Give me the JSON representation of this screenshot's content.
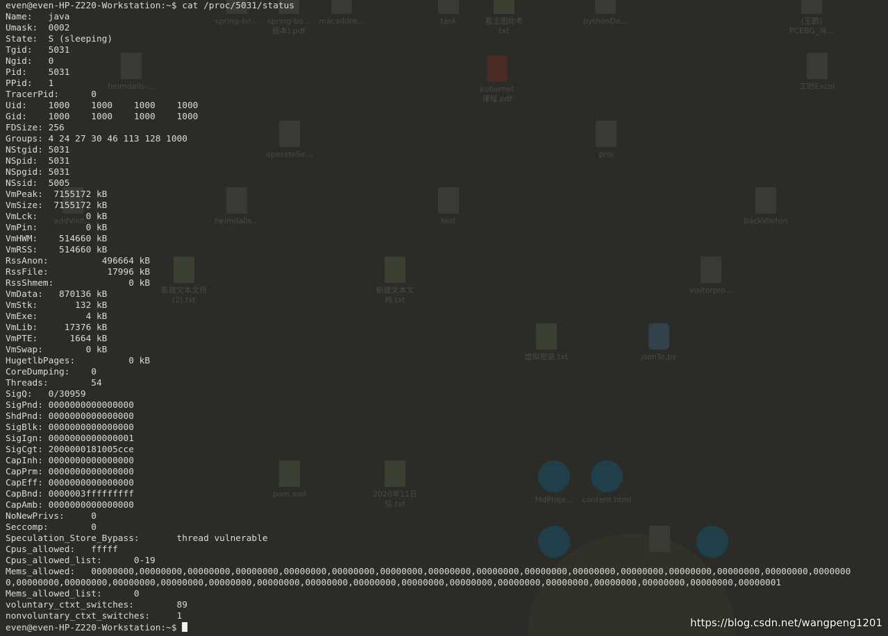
{
  "terminal": {
    "prompt": "even@even-HP-Z220-Workstation:~$",
    "command": "cat /proc/5031/status",
    "output": [
      "Name:\tjava",
      "Umask:\t0002",
      "State:\tS (sleeping)",
      "Tgid:\t5031",
      "Ngid:\t0",
      "Pid:\t5031",
      "PPid:\t1",
      "TracerPid:\t0",
      "Uid:\t1000\t1000\t1000\t1000",
      "Gid:\t1000\t1000\t1000\t1000",
      "FDSize:\t256",
      "Groups:\t4 24 27 30 46 113 128 1000",
      "NStgid:\t5031",
      "NSpid:\t5031",
      "NSpgid:\t5031",
      "NSsid:\t5005",
      "VmPeak:\t 7155172 kB",
      "VmSize:\t 7155172 kB",
      "VmLck:\t       0 kB",
      "VmPin:\t       0 kB",
      "VmHWM:\t  514660 kB",
      "VmRSS:\t  514660 kB",
      "RssAnon:\t  496664 kB",
      "RssFile:\t   17996 kB",
      "RssShmem:\t       0 kB",
      "VmData:\t  870136 kB",
      "VmStk:\t     132 kB",
      "VmExe:\t       4 kB",
      "VmLib:\t   17376 kB",
      "VmPTE:\t    1664 kB",
      "VmSwap:\t       0 kB",
      "HugetlbPages:\t       0 kB",
      "CoreDumping:\t0",
      "Threads:\t54",
      "SigQ:\t0/30959",
      "SigPnd:\t0000000000000000",
      "ShdPnd:\t0000000000000000",
      "SigBlk:\t0000000000000000",
      "SigIgn:\t0000000000000001",
      "SigCgt:\t2000000181005cce",
      "CapInh:\t0000000000000000",
      "CapPrm:\t0000000000000000",
      "CapEff:\t0000000000000000",
      "CapBnd:\t0000003fffffffff",
      "CapAmb:\t0000000000000000",
      "NoNewPrivs:\t0",
      "Seccomp:\t0",
      "Speculation_Store_Bypass:\tthread vulnerable",
      "Cpus_allowed:\tfffff",
      "Cpus_allowed_list:\t0-19",
      "Mems_allowed:\t00000000,00000000,00000000,00000000,00000000,00000000,00000000,00000000,00000000,00000000,00000000,00000000,00000000,00000000,00000000,0000000",
      "0,00000000,00000000,00000000,00000000,00000000,00000000,00000000,00000000,00000000,00000000,00000000,00000000,00000000,00000000,00000000,00000001",
      "Mems_allowed_list:\t0",
      "voluntary_ctxt_switches:\t89",
      "nonvoluntary_ctxt_switches:\t1"
    ]
  },
  "watermark": "https://blog.csdn.net/wangpeng1201",
  "desktop_icons": [
    {
      "label": "spring-bo...",
      "icon": "file-icon",
      "kind": "doc"
    },
    {
      "label": "spring-bo...\n版本).pdf",
      "icon": "file-icon",
      "kind": "doc"
    },
    {
      "label": "macaddre...",
      "icon": "file-icon",
      "kind": "doc"
    },
    {
      "label": "task",
      "icon": "folder-icon",
      "kind": "doc"
    },
    {
      "label": "看主图你考\ntxt",
      "icon": "text-file-icon",
      "kind": "txt"
    },
    {
      "label": "pythonDe...",
      "icon": "folder-icon",
      "kind": "doc"
    },
    {
      "label": "(王鹏)\nPCEBG_鸿...",
      "icon": "word-file-icon",
      "kind": "doc"
    },
    {
      "label": "heimdalls-...",
      "icon": "file-icon",
      "kind": "doc"
    },
    {
      "label": "kubernet\n课程.pdf",
      "icon": "pdf-file-icon",
      "kind": "pdf"
    },
    {
      "label": "工时Excel",
      "icon": "file-icon",
      "kind": "doc"
    },
    {
      "label": "operateSe...",
      "icon": "file-icon",
      "kind": "doc"
    },
    {
      "label": "proj",
      "icon": "file-icon",
      "kind": "doc"
    },
    {
      "label": "addVisit...",
      "icon": "file-icon",
      "kind": "doc"
    },
    {
      "label": "heimdalls...",
      "icon": "file-icon",
      "kind": "doc"
    },
    {
      "label": "test",
      "icon": "file-icon",
      "kind": "doc"
    },
    {
      "label": "backVisiton",
      "icon": "file-icon",
      "kind": "doc"
    },
    {
      "label": "新建文本文档\n(2).txt",
      "icon": "text-file-icon",
      "kind": "txt"
    },
    {
      "label": "新建文本文\n档.txt",
      "icon": "text-file-icon",
      "kind": "txt"
    },
    {
      "label": "visitorpro...",
      "icon": "file-icon",
      "kind": "doc"
    },
    {
      "label": "虚拟密装.txt",
      "icon": "text-file-icon",
      "kind": "txt"
    },
    {
      "label": "jsonTe.py",
      "icon": "python-file-icon",
      "kind": "py"
    },
    {
      "label": "pom.xml",
      "icon": "text-file-icon",
      "kind": "txt"
    },
    {
      "label": "2020年11日\n信.txt",
      "icon": "text-file-icon",
      "kind": "txt"
    },
    {
      "label": "MdProje...",
      "icon": "edge-browser-icon",
      "kind": "edge"
    },
    {
      "label": "content.html",
      "icon": "edge-browser-icon",
      "kind": "edge"
    },
    {
      "label": "",
      "icon": "edge-browser-icon",
      "kind": "edge"
    },
    {
      "label": "",
      "icon": "file-icon",
      "kind": "doc"
    },
    {
      "label": "",
      "icon": "edge-browser-icon",
      "kind": "edge"
    }
  ]
}
